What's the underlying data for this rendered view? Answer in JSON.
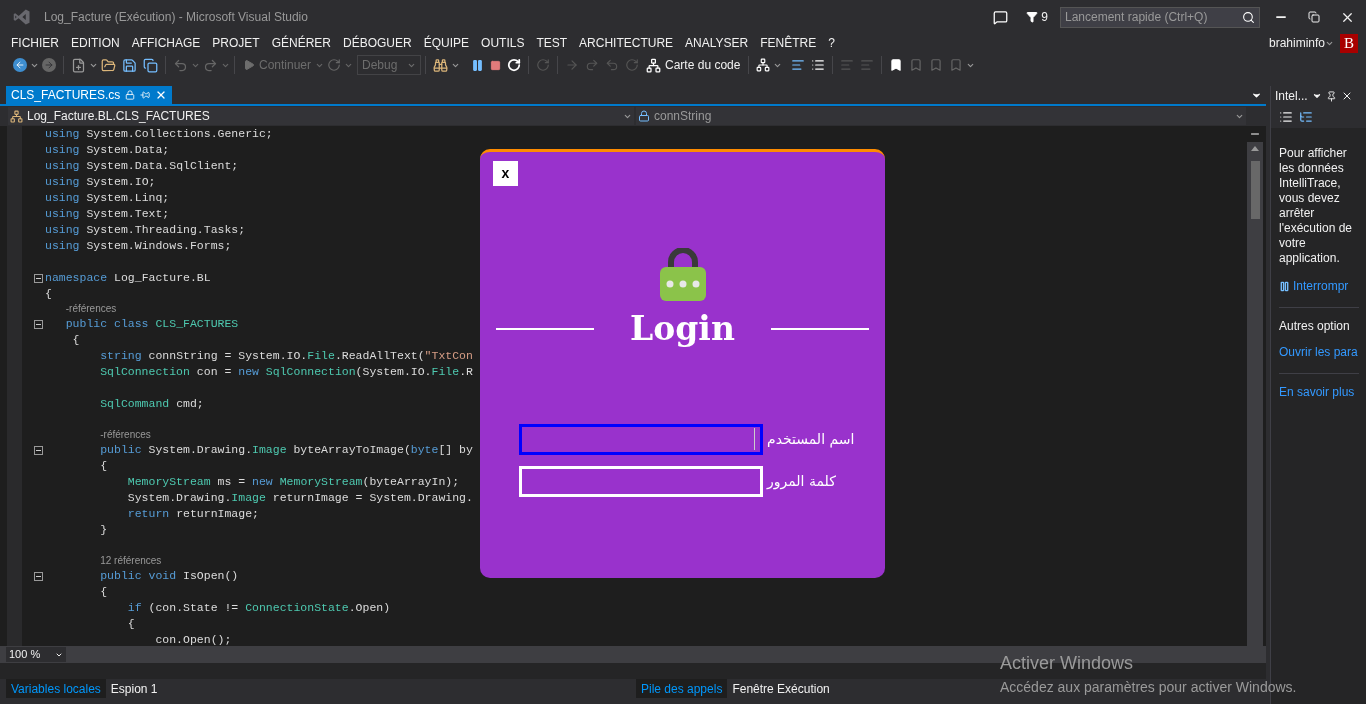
{
  "window": {
    "title": "Log_Facture (Exécution) - Microsoft Visual Studio",
    "notifications": "9",
    "quick_launch": {
      "placeholder": "Lancement rapide (Ctrl+Q)"
    },
    "user": "brahiminfo",
    "avatar": "B"
  },
  "menu": [
    "FICHIER",
    "EDITION",
    "AFFICHAGE",
    "PROJET",
    "GÉNÉRER",
    "DÉBOGUER",
    "ÉQUIPE",
    "OUTILS",
    "TEST",
    "ARCHITECTURE",
    "ANALYSER",
    "FENÊTRE",
    "?"
  ],
  "toolbar": {
    "continue": "Continuer",
    "configuration": "Debug",
    "code_map": "Carte du code"
  },
  "document_tabs": [
    {
      "label": "CLS_FACTURES.cs",
      "selected": true
    }
  ],
  "navigation": {
    "type": "Log_Facture.BL.CLS_FACTURES",
    "member": "connString"
  },
  "code_lines": [
    {
      "kind": "code",
      "tokens": [
        {
          "kind": "keyword",
          "text": "using"
        },
        {
          "kind": "plain",
          "text": " System.Collections.Generic;"
        }
      ]
    },
    {
      "kind": "code",
      "tokens": [
        {
          "kind": "keyword",
          "text": "using"
        },
        {
          "kind": "plain",
          "text": " System.Data;"
        }
      ]
    },
    {
      "kind": "code",
      "tokens": [
        {
          "kind": "keyword",
          "text": "using"
        },
        {
          "kind": "plain",
          "text": " System.Data.SqlClient;"
        }
      ]
    },
    {
      "kind": "code",
      "tokens": [
        {
          "kind": "keyword",
          "text": "using"
        },
        {
          "kind": "plain",
          "text": " System.IO;"
        }
      ]
    },
    {
      "kind": "code",
      "tokens": [
        {
          "kind": "keyword",
          "text": "using"
        },
        {
          "kind": "plain",
          "text": " System.Linq;"
        }
      ]
    },
    {
      "kind": "code",
      "tokens": [
        {
          "kind": "keyword",
          "text": "using"
        },
        {
          "kind": "plain",
          "text": " System.Text;"
        }
      ]
    },
    {
      "kind": "code",
      "tokens": [
        {
          "kind": "keyword",
          "text": "using"
        },
        {
          "kind": "plain",
          "text": " System.Threading.Tasks;"
        }
      ]
    },
    {
      "kind": "code",
      "tokens": [
        {
          "kind": "keyword",
          "text": "using"
        },
        {
          "kind": "plain",
          "text": " System.Windows.Forms;"
        }
      ]
    },
    {
      "kind": "blank"
    },
    {
      "kind": "fold",
      "tokens": [
        {
          "kind": "keyword",
          "text": "namespace"
        },
        {
          "kind": "plain",
          "text": " Log_Facture.BL"
        }
      ]
    },
    {
      "kind": "code",
      "tokens": [
        {
          "kind": "plain",
          "text": "{"
        }
      ]
    },
    {
      "kind": "lens",
      "tokens": [
        {
          "kind": "lens",
          "text": "   -références"
        }
      ]
    },
    {
      "kind": "fold",
      "tokens": [
        {
          "kind": "keyword",
          "text": "   public class"
        },
        {
          "kind": "type",
          "text": " CLS_FACTURES"
        }
      ]
    },
    {
      "kind": "code",
      "tokens": [
        {
          "kind": "plain",
          "text": "    {"
        }
      ]
    },
    {
      "kind": "code",
      "tokens": [
        {
          "kind": "keyword",
          "text": "        string"
        },
        {
          "kind": "plain",
          "text": " connString = System.IO."
        },
        {
          "kind": "type",
          "text": "File"
        },
        {
          "kind": "plain",
          "text": ".ReadAllText("
        },
        {
          "kind": "string",
          "text": "\"TxtCon"
        }
      ]
    },
    {
      "kind": "code",
      "tokens": [
        {
          "kind": "type",
          "text": "        SqlConnection"
        },
        {
          "kind": "plain",
          "text": " con = "
        },
        {
          "kind": "keyword",
          "text": "new"
        },
        {
          "kind": "type",
          "text": " SqlConnection"
        },
        {
          "kind": "plain",
          "text": "(System.IO."
        },
        {
          "kind": "type",
          "text": "File"
        },
        {
          "kind": "plain",
          "text": ".R"
        }
      ]
    },
    {
      "kind": "blank"
    },
    {
      "kind": "code",
      "tokens": [
        {
          "kind": "type",
          "text": "        SqlCommand"
        },
        {
          "kind": "plain",
          "text": " cmd;"
        }
      ]
    },
    {
      "kind": "blank"
    },
    {
      "kind": "lens",
      "tokens": [
        {
          "kind": "lens",
          "text": "        -références"
        }
      ]
    },
    {
      "kind": "fold",
      "tokens": [
        {
          "kind": "keyword",
          "text": "        public"
        },
        {
          "kind": "plain",
          "text": " System.Drawing."
        },
        {
          "kind": "type",
          "text": "Image"
        },
        {
          "kind": "plain",
          "text": " byteArrayToImage("
        },
        {
          "kind": "keyword",
          "text": "byte"
        },
        {
          "kind": "plain",
          "text": "[] by"
        }
      ]
    },
    {
      "kind": "code",
      "tokens": [
        {
          "kind": "plain",
          "text": "        {"
        }
      ]
    },
    {
      "kind": "code",
      "tokens": [
        {
          "kind": "type",
          "text": "            MemoryStream"
        },
        {
          "kind": "plain",
          "text": " ms = "
        },
        {
          "kind": "keyword",
          "text": "new"
        },
        {
          "kind": "type",
          "text": " MemoryStream"
        },
        {
          "kind": "plain",
          "text": "(byteArrayIn);"
        }
      ]
    },
    {
      "kind": "code",
      "tokens": [
        {
          "kind": "plain",
          "text": "            System.Drawing."
        },
        {
          "kind": "type",
          "text": "Image"
        },
        {
          "kind": "plain",
          "text": " returnImage = System.Drawing."
        }
      ]
    },
    {
      "kind": "code",
      "tokens": [
        {
          "kind": "keyword",
          "text": "            return"
        },
        {
          "kind": "plain",
          "text": " returnImage;"
        }
      ]
    },
    {
      "kind": "code",
      "tokens": [
        {
          "kind": "plain",
          "text": "        }"
        }
      ]
    },
    {
      "kind": "blank"
    },
    {
      "kind": "lens",
      "tokens": [
        {
          "kind": "lens",
          "text": "        12 références"
        }
      ]
    },
    {
      "kind": "fold",
      "tokens": [
        {
          "kind": "keyword",
          "text": "        public void"
        },
        {
          "kind": "plain",
          "text": " IsOpen()"
        }
      ]
    },
    {
      "kind": "code",
      "tokens": [
        {
          "kind": "plain",
          "text": "        {"
        }
      ]
    },
    {
      "kind": "code",
      "tokens": [
        {
          "kind": "keyword",
          "text": "            if"
        },
        {
          "kind": "plain",
          "text": " (con.State != "
        },
        {
          "kind": "type",
          "text": "ConnectionState"
        },
        {
          "kind": "plain",
          "text": ".Open)"
        }
      ]
    },
    {
      "kind": "code",
      "tokens": [
        {
          "kind": "plain",
          "text": "            {"
        }
      ]
    },
    {
      "kind": "code",
      "tokens": [
        {
          "kind": "plain",
          "text": "                con.Open();"
        }
      ]
    }
  ],
  "zoom": "100 %",
  "login_dialog": {
    "close": "x",
    "title": "Login",
    "fields": [
      {
        "label": "اسم المستخدم",
        "focused": true
      },
      {
        "label": "كلمة المرور",
        "focused": false
      }
    ]
  },
  "intellitrace": {
    "title": "Intel...",
    "message": "Pour afficher les données IntelliTrace, vous devez arrêter l'exécution de votre application.",
    "break_link": "Interrompr",
    "more_options": "Autres option",
    "open_settings": "Ouvrir les para",
    "learn_more": "En savoir plus"
  },
  "bottom_tabs_left": [
    {
      "label": "Variables locales",
      "selected": true
    },
    {
      "label": "Espion 1",
      "selected": false
    }
  ],
  "bottom_tabs_right": [
    {
      "label": "Pile des appels",
      "selected": true
    },
    {
      "label": "Fenêtre Exécution",
      "selected": false
    }
  ],
  "activation_notice": {
    "title": "Activer Windows",
    "text": "Accédez aux paramètres pour activer Windows."
  }
}
